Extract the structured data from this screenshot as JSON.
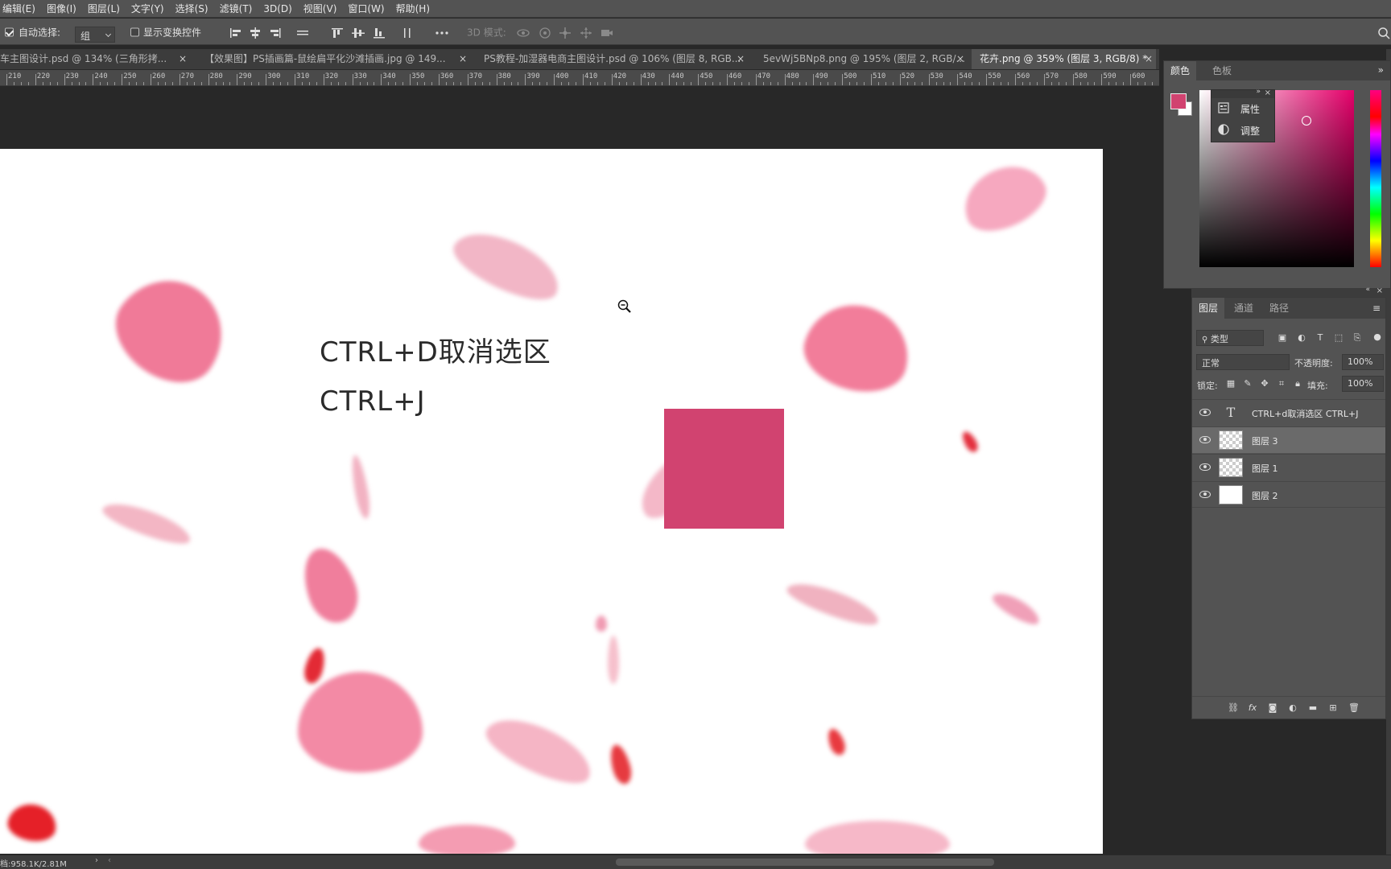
{
  "menu": [
    "编辑(E)",
    "图像(I)",
    "图层(L)",
    "文字(Y)",
    "选择(S)",
    "滤镜(T)",
    "3D(D)",
    "视图(V)",
    "窗口(W)",
    "帮助(H)"
  ],
  "options": {
    "auto_select_label": "自动选择:",
    "auto_select_value": "组",
    "show_transform_label": "显示变换控件",
    "mode_3d_label": "3D 模式:"
  },
  "tabs": [
    {
      "label": "车主图设计.psd @ 134% (三角形拷..."
    },
    {
      "label": "【效果图】PS插画篇-鼠绘扁平化沙滩插画.jpg @ 149..."
    },
    {
      "label": "PS教程-加湿器电商主图设计.psd @ 106% (图层 8, RGB..."
    },
    {
      "label": "5evWj5BNp8.png @ 195% (图层 2, RGB/..."
    },
    {
      "label": "花卉.png @ 359% (图层 3, RGB/8) *"
    }
  ],
  "ruler_ticks": [
    "210",
    "220",
    "230",
    "240",
    "250",
    "260",
    "270",
    "280",
    "290",
    "300",
    "310",
    "320",
    "330",
    "340",
    "350",
    "360",
    "370",
    "380",
    "390",
    "400",
    "410",
    "420",
    "430",
    "440",
    "450",
    "460",
    "470",
    "480",
    "490",
    "500",
    "510",
    "520",
    "530",
    "540",
    "550",
    "560",
    "570",
    "580",
    "590",
    "600"
  ],
  "canvas": {
    "line1": "CTRL+D取消选区",
    "line2": "CTRL+J",
    "square_color": "#d14370"
  },
  "color_panel": {
    "tabs": [
      "颜色",
      "色板"
    ],
    "fg_color": "#d14370",
    "bg_color": "#ffffff"
  },
  "flyout": {
    "items": [
      "属性",
      "调整"
    ]
  },
  "layers_panel": {
    "tabs": [
      "图层",
      "通道",
      "路径"
    ],
    "filter_label": "类型",
    "blend_mode": "正常",
    "opacity_label": "不透明度:",
    "opacity_value": "100%",
    "lock_label": "锁定:",
    "fill_label": "填充:",
    "fill_value": "100%",
    "layers": [
      {
        "name": "CTRL+d取消选区  CTRL+J",
        "type": "text"
      },
      {
        "name": "图层 3",
        "type": "transparent",
        "selected": true
      },
      {
        "name": "图层 1",
        "type": "transparent"
      },
      {
        "name": "图层 2",
        "type": "white"
      }
    ]
  },
  "status": {
    "doc_size": "档:958.1K/2.81M"
  }
}
